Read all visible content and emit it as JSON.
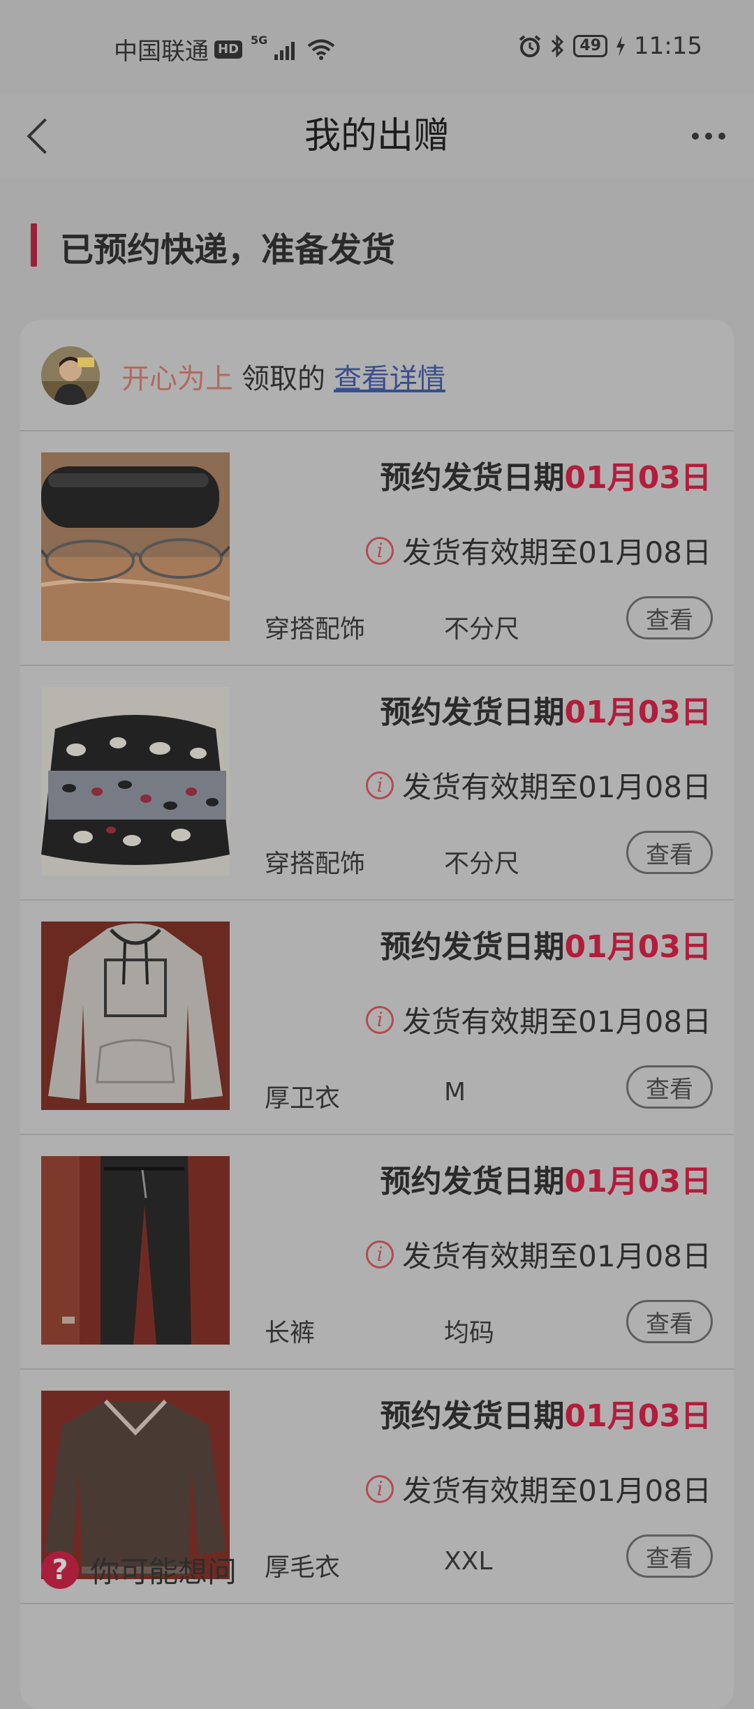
{
  "status_bar": {
    "carrier": "中国联通",
    "hd": "HD",
    "network": "5G",
    "signal_icon": "signal-icon",
    "wifi_icon": "wifi-icon",
    "alarm_icon": "alarm-icon",
    "bluetooth_icon": "bluetooth-icon",
    "battery": "49",
    "charging_icon": "charging-icon",
    "time": "11:15"
  },
  "header": {
    "title": "我的出赠",
    "back_icon": "back-arrow-icon",
    "more_icon": "more-icon"
  },
  "section": {
    "title": "已预约快递，准备发货"
  },
  "card": {
    "receiver_name": "开心为上",
    "received_label": "领取的",
    "detail_link": "查看详情",
    "items": [
      {
        "ship_prefix": "预约发货日期",
        "ship_date": "01月03日",
        "validity": "发货有效期至01月08日",
        "category": "穿搭配饰",
        "size": "不分尺",
        "view_label": "查看"
      },
      {
        "ship_prefix": "预约发货日期",
        "ship_date": "01月03日",
        "validity": "发货有效期至01月08日",
        "category": "穿搭配饰",
        "size": "不分尺",
        "view_label": "查看"
      },
      {
        "ship_prefix": "预约发货日期",
        "ship_date": "01月03日",
        "validity": "发货有效期至01月08日",
        "category": "厚卫衣",
        "size": "M",
        "view_label": "查看"
      },
      {
        "ship_prefix": "预约发货日期",
        "ship_date": "01月03日",
        "validity": "发货有效期至01月08日",
        "category": "长裤",
        "size": "均码",
        "view_label": "查看"
      },
      {
        "ship_prefix": "预约发货日期",
        "ship_date": "01月03日",
        "validity": "发货有效期至01月08日",
        "category": "厚毛衣",
        "size": "XXL",
        "view_label": "查看"
      }
    ]
  },
  "faq": {
    "icon": "question-icon",
    "label": "你可能想问"
  },
  "colors": {
    "accent": "#b31c3c",
    "link": "#3a4e8c",
    "receiver": "#b06a60",
    "overlay_background": "#a9a9a9"
  }
}
